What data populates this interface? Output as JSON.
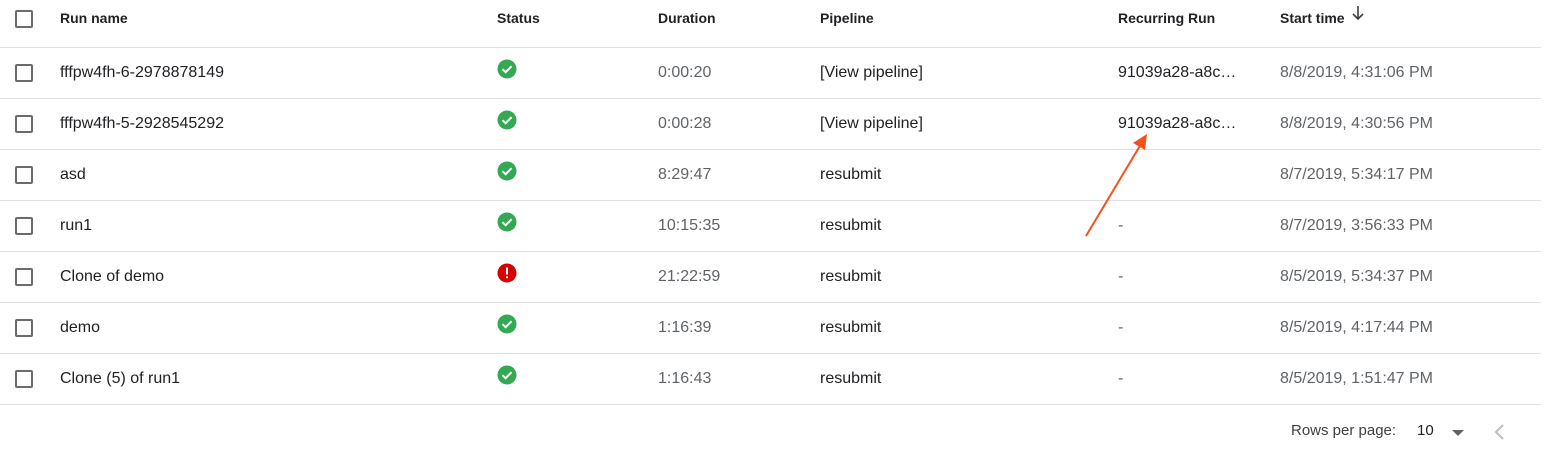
{
  "columns": {
    "name": "Run name",
    "status": "Status",
    "duration": "Duration",
    "pipeline": "Pipeline",
    "recurring": "Recurring Run",
    "start": "Start time"
  },
  "rows": [
    {
      "name": "fffpw4fh-6-2978878149",
      "status": "success",
      "duration": "0:00:20",
      "pipeline": "[View pipeline]",
      "recurring": "91039a28-a8c…",
      "start": "8/8/2019, 4:31:06 PM"
    },
    {
      "name": "fffpw4fh-5-2928545292",
      "status": "success",
      "duration": "0:00:28",
      "pipeline": "[View pipeline]",
      "recurring": "91039a28-a8c…",
      "start": "8/8/2019, 4:30:56 PM"
    },
    {
      "name": "asd",
      "status": "success",
      "duration": "8:29:47",
      "pipeline": "resubmit",
      "recurring": "",
      "start": "8/7/2019, 5:34:17 PM"
    },
    {
      "name": "run1",
      "status": "success",
      "duration": "10:15:35",
      "pipeline": "resubmit",
      "recurring": "-",
      "start": "8/7/2019, 3:56:33 PM"
    },
    {
      "name": "Clone of demo",
      "status": "error",
      "duration": "21:22:59",
      "pipeline": "resubmit",
      "recurring": "-",
      "start": "8/5/2019, 5:34:37 PM"
    },
    {
      "name": "demo",
      "status": "success",
      "duration": "1:16:39",
      "pipeline": "resubmit",
      "recurring": "-",
      "start": "8/5/2019, 4:17:44 PM"
    },
    {
      "name": "Clone (5) of run1",
      "status": "success",
      "duration": "1:16:43",
      "pipeline": "resubmit",
      "recurring": "-",
      "start": "8/5/2019, 1:51:47 PM"
    }
  ],
  "footer": {
    "rows_per_page_label": "Rows per page:",
    "rows_per_page_value": "10"
  },
  "icons": {
    "success": "check-circle-icon",
    "error": "error-circle-icon",
    "sort": "arrow-down-icon",
    "dropdown": "caret-down-icon",
    "prev": "chevron-left-icon"
  },
  "colors": {
    "success": "#34a853",
    "error": "#d50000",
    "annotation_arrow": "#f4511e"
  }
}
